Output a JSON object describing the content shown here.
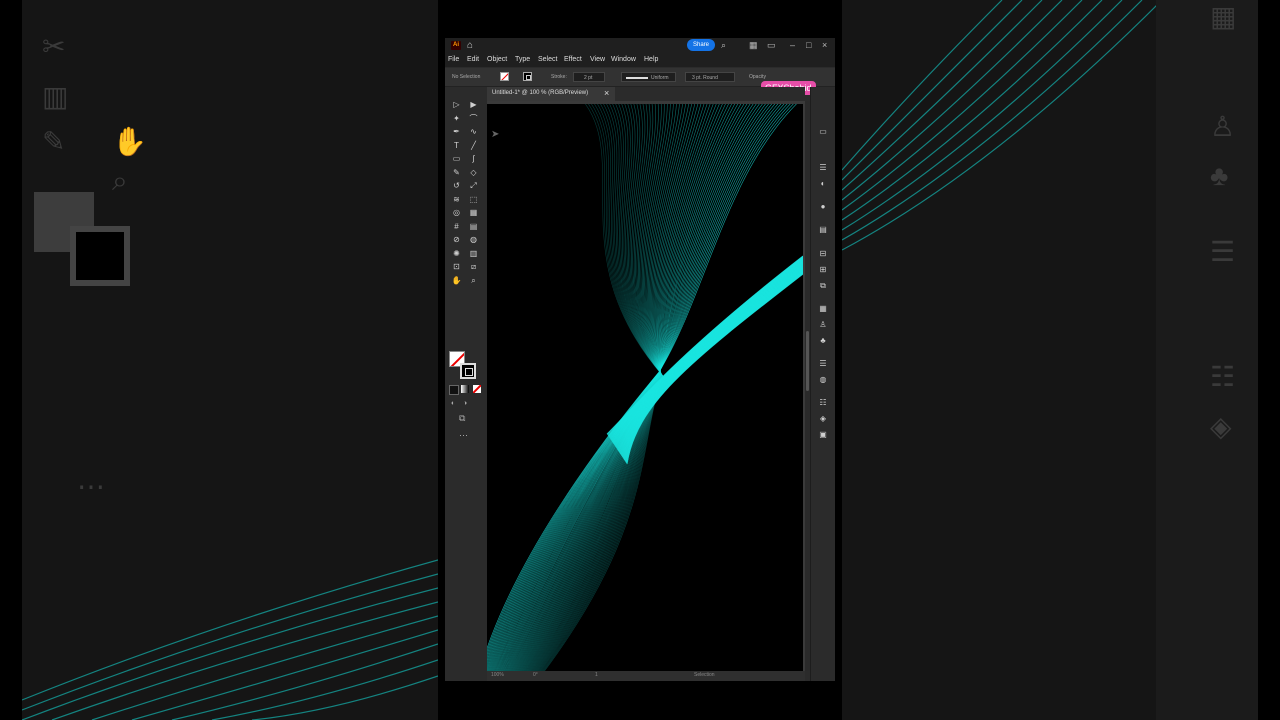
{
  "window": {
    "app_logo": "Ai",
    "share_label": "Share"
  },
  "menu": [
    "File",
    "Edit",
    "Object",
    "Type",
    "Select",
    "Effect",
    "View",
    "Window",
    "Help"
  ],
  "control_bar": {
    "selection_state": "No Selection",
    "stroke_label": "Stroke:",
    "stroke_weight": "2 pt",
    "profile": "Uniform",
    "brush": "3 pt. Round",
    "opacity_label": "Opacity"
  },
  "watermark": "GFXShahid",
  "document_tab": {
    "title": "Untitled-1* @ 100 % (RGB/Preview)",
    "close": "×"
  },
  "status_bar": {
    "zoom": "100%",
    "rotation": "0°",
    "artboard": "1",
    "tool": "Selection"
  },
  "colors": {
    "accent": "#1473e6",
    "artwork": "#19e6e0",
    "watermark": "#e64ea8",
    "ui_dark": "#2b2b2b"
  },
  "tools": [
    "selection-tool",
    "direct-selection-tool",
    "magic-wand-tool",
    "lasso-tool",
    "pen-tool",
    "curvature-tool",
    "type-tool",
    "line-tool",
    "rectangle-tool",
    "paintbrush-tool",
    "pencil-tool",
    "eraser-tool",
    "rotate-tool",
    "scale-tool",
    "warp-tool",
    "free-transform-tool",
    "shape-builder-tool",
    "perspective-grid-tool",
    "mesh-tool",
    "gradient-tool",
    "eyedropper-tool",
    "blend-tool",
    "symbol-sprayer-tool",
    "column-graph-tool",
    "artboard-tool",
    "slice-tool",
    "hand-tool",
    "zoom-tool"
  ]
}
